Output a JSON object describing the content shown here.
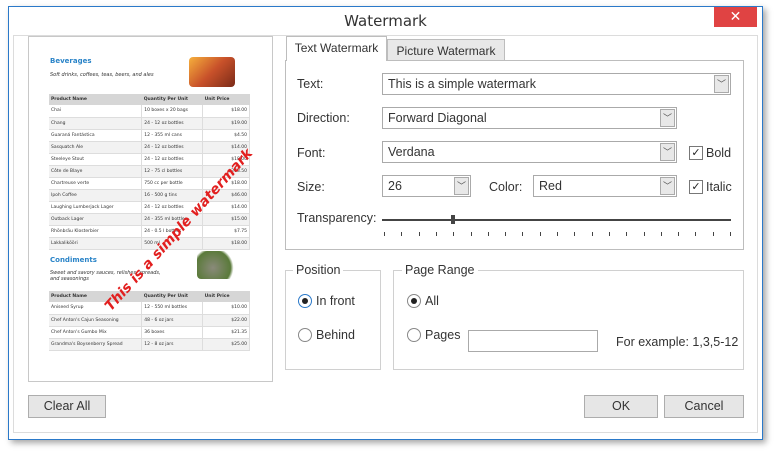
{
  "window": {
    "title": "Watermark",
    "close_icon": "close-icon"
  },
  "preview": {
    "sections": [
      {
        "title": "Beverages",
        "subtitle": "Soft drinks, coffees, teas, beers, and ales",
        "columns": [
          "Product Name",
          "Quantity Per Unit",
          "Unit Price"
        ],
        "rows": [
          [
            "Chai",
            "10 boxes x 20 bags",
            "$18.00"
          ],
          [
            "Chang",
            "24 - 12 oz bottles",
            "$19.00"
          ],
          [
            "Guaraná Fantástica",
            "12 - 355 ml cans",
            "$4.50"
          ],
          [
            "Sasquatch Ale",
            "24 - 12 oz bottles",
            "$14.00"
          ],
          [
            "Steeleye Stout",
            "24 - 12 oz bottles",
            "$18.00"
          ],
          [
            "Côte de Blaye",
            "12 - 75 cl bottles",
            "$263.50"
          ],
          [
            "Chartreuse verte",
            "750 cc per bottle",
            "$18.00"
          ],
          [
            "Ipoh Coffee",
            "16 - 500 g tins",
            "$46.00"
          ],
          [
            "Laughing Lumberjack Lager",
            "24 - 12 oz bottles",
            "$14.00"
          ],
          [
            "Outback Lager",
            "24 - 355 ml bottles",
            "$15.00"
          ],
          [
            "Rhönbräu Klosterbier",
            "24 - 0.5 l bottles",
            "$7.75"
          ],
          [
            "Lakkalikööri",
            "500 ml",
            "$18.00"
          ]
        ]
      },
      {
        "title": "Condiments",
        "subtitle": "Sweet and savory sauces, relishes, spreads, and seasonings",
        "columns": [
          "Product Name",
          "Quantity Per Unit",
          "Unit Price"
        ],
        "rows": [
          [
            "Aniseed Syrup",
            "12 - 550 ml bottles",
            "$10.00"
          ],
          [
            "Chef Anton's Cajun Seasoning",
            "48 - 6 oz jars",
            "$22.00"
          ],
          [
            "Chef Anton's Gumbo Mix",
            "36 boxes",
            "$21.35"
          ],
          [
            "Grandma's Boysenberry Spread",
            "12 - 8 oz jars",
            "$25.00"
          ]
        ]
      }
    ],
    "watermark_text": "This is a simple watermark",
    "watermark_color": "#e21f1f"
  },
  "tabs": [
    {
      "label": "Text Watermark",
      "active": true
    },
    {
      "label": "Picture Watermark",
      "active": false
    }
  ],
  "text_tab": {
    "text_label": "Text:",
    "text_value": "This is a simple watermark",
    "direction_label": "Direction:",
    "direction_value": "Forward Diagonal",
    "font_label": "Font:",
    "font_value": "Verdana",
    "bold_label": "Bold",
    "bold_checked": true,
    "size_label": "Size:",
    "size_value": "26",
    "color_label": "Color:",
    "color_value": "Red",
    "italic_label": "Italic",
    "italic_checked": true,
    "transparency_label": "Transparency:",
    "transparency_percent": 20
  },
  "position": {
    "legend": "Position",
    "options": [
      {
        "label": "In front",
        "selected": true
      },
      {
        "label": "Behind",
        "selected": false
      }
    ]
  },
  "page_range": {
    "legend": "Page Range",
    "all_label": "All",
    "pages_label": "Pages",
    "selected": "All",
    "pages_value": "",
    "example": "For example: 1,3,5-12"
  },
  "buttons": {
    "clear_all": "Clear All",
    "ok": "OK",
    "cancel": "Cancel"
  },
  "colors": {
    "accent": "#2b79c9",
    "close": "#e04343"
  }
}
